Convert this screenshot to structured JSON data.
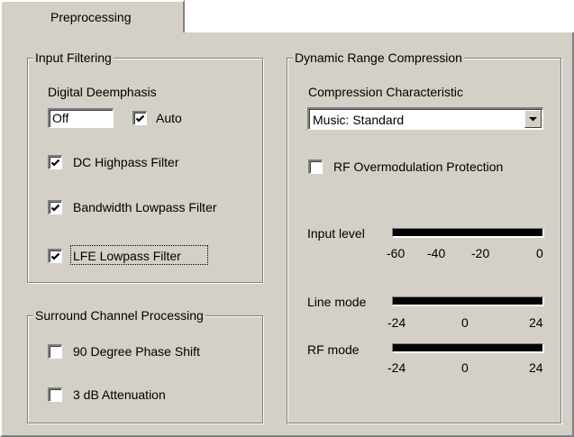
{
  "tab": {
    "label": "Preprocessing"
  },
  "input_filtering": {
    "title": "Input Filtering",
    "deemphasis_label": "Digital Deemphasis",
    "deemphasis_value": "Off",
    "auto_label": "Auto",
    "auto_checked": true,
    "dc_highpass_label": "DC Highpass Filter",
    "dc_highpass_checked": true,
    "bandwidth_lowpass_label": "Bandwidth Lowpass Filter",
    "bandwidth_lowpass_checked": true,
    "lfe_lowpass_label": "LFE Lowpass Filter",
    "lfe_lowpass_checked": true
  },
  "surround": {
    "title": "Surround Channel Processing",
    "phase_shift_label": "90 Degree Phase Shift",
    "phase_shift_checked": false,
    "attenuation_label": "3 dB Attenuation",
    "attenuation_checked": false
  },
  "drc": {
    "title": "Dynamic Range Compression",
    "characteristic_label": "Compression Characteristic",
    "characteristic_value": "Music: Standard",
    "rf_overmod_label": "RF Overmodulation Protection",
    "rf_overmod_checked": false,
    "input_level": {
      "label": "Input level",
      "ticks": [
        "-60",
        "-40",
        "-20",
        "0"
      ]
    },
    "line_mode": {
      "label": "Line mode",
      "ticks": [
        "-24",
        "0",
        "24"
      ]
    },
    "rf_mode": {
      "label": "RF mode",
      "ticks": [
        "-24",
        "0",
        "24"
      ]
    }
  }
}
